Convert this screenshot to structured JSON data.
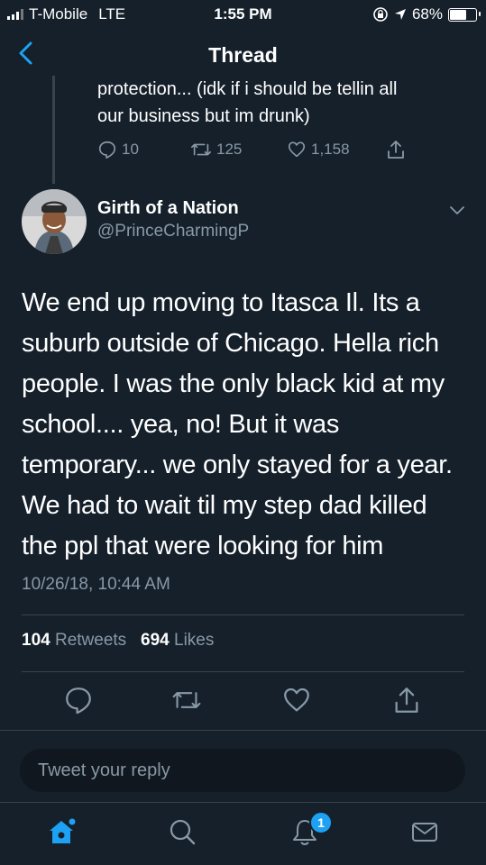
{
  "status_bar": {
    "carrier": "T-Mobile",
    "network": "LTE",
    "time": "1:55 PM",
    "battery_percent": "68%",
    "battery_level": 0.68
  },
  "nav": {
    "title": "Thread",
    "back_icon": "chevron-left-icon"
  },
  "previous_tweet": {
    "text_line1": "protection... (idk if i should be tellin all",
    "text_line2": "our business but im drunk)",
    "replies": "10",
    "retweets": "125",
    "likes": "1,158"
  },
  "author": {
    "name": "Girth of a Nation",
    "handle": "@PrinceCharmingP"
  },
  "tweet": {
    "lines": [
      "We end up moving to Itasca Il. Its a",
      "suburb outside of Chicago. Hella rich",
      "people. I was the only black kid at my",
      "school.... yea, no! But it was",
      "temporary... we only stayed for a year.",
      "We had to wait til my step dad killed",
      "the ppl that were looking for him"
    ],
    "timestamp": "10/26/18, 10:44 AM",
    "retweet_count": "104",
    "retweet_label": "Retweets",
    "like_count": "694",
    "like_label": "Likes"
  },
  "reply": {
    "placeholder": "Tweet your reply"
  },
  "tabbar": {
    "notification_badge": "1"
  },
  "colors": {
    "background": "#15202b",
    "secondary_text": "#8899a6",
    "divider": "#38444d",
    "accent": "#1da1f2"
  }
}
